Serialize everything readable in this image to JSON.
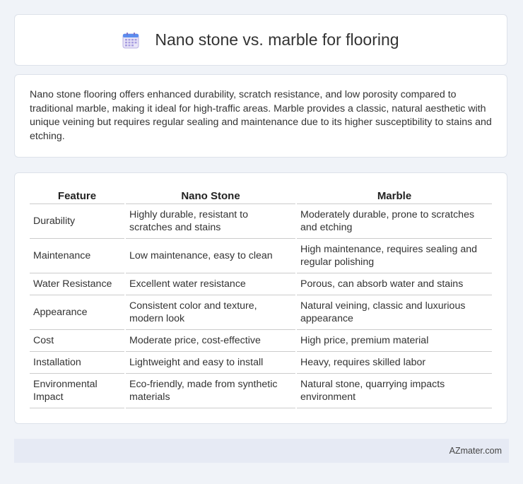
{
  "header": {
    "title": "Nano stone vs. marble for flooring",
    "icon": "calendar-icon"
  },
  "summary": {
    "text": "Nano stone flooring offers enhanced durability, scratch resistance, and low porosity compared to traditional marble, making it ideal for high-traffic areas. Marble provides a classic, natural aesthetic with unique veining but requires regular sealing and maintenance due to its higher susceptibility to stains and etching."
  },
  "table": {
    "headers": [
      "Feature",
      "Nano Stone",
      "Marble"
    ],
    "rows": [
      [
        "Durability",
        "Highly durable, resistant to scratches and stains",
        "Moderately durable, prone to scratches and etching"
      ],
      [
        "Maintenance",
        "Low maintenance, easy to clean",
        "High maintenance, requires sealing and regular polishing"
      ],
      [
        "Water Resistance",
        "Excellent water resistance",
        "Porous, can absorb water and stains"
      ],
      [
        "Appearance",
        "Consistent color and texture, modern look",
        "Natural veining, classic and luxurious appearance"
      ],
      [
        "Cost",
        "Moderate price, cost-effective",
        "High price, premium material"
      ],
      [
        "Installation",
        "Lightweight and easy to install",
        "Heavy, requires skilled labor"
      ],
      [
        "Environmental Impact",
        "Eco-friendly, made from synthetic materials",
        "Natural stone, quarrying impacts environment"
      ]
    ]
  },
  "footer": {
    "brand": "AZmater.com"
  }
}
